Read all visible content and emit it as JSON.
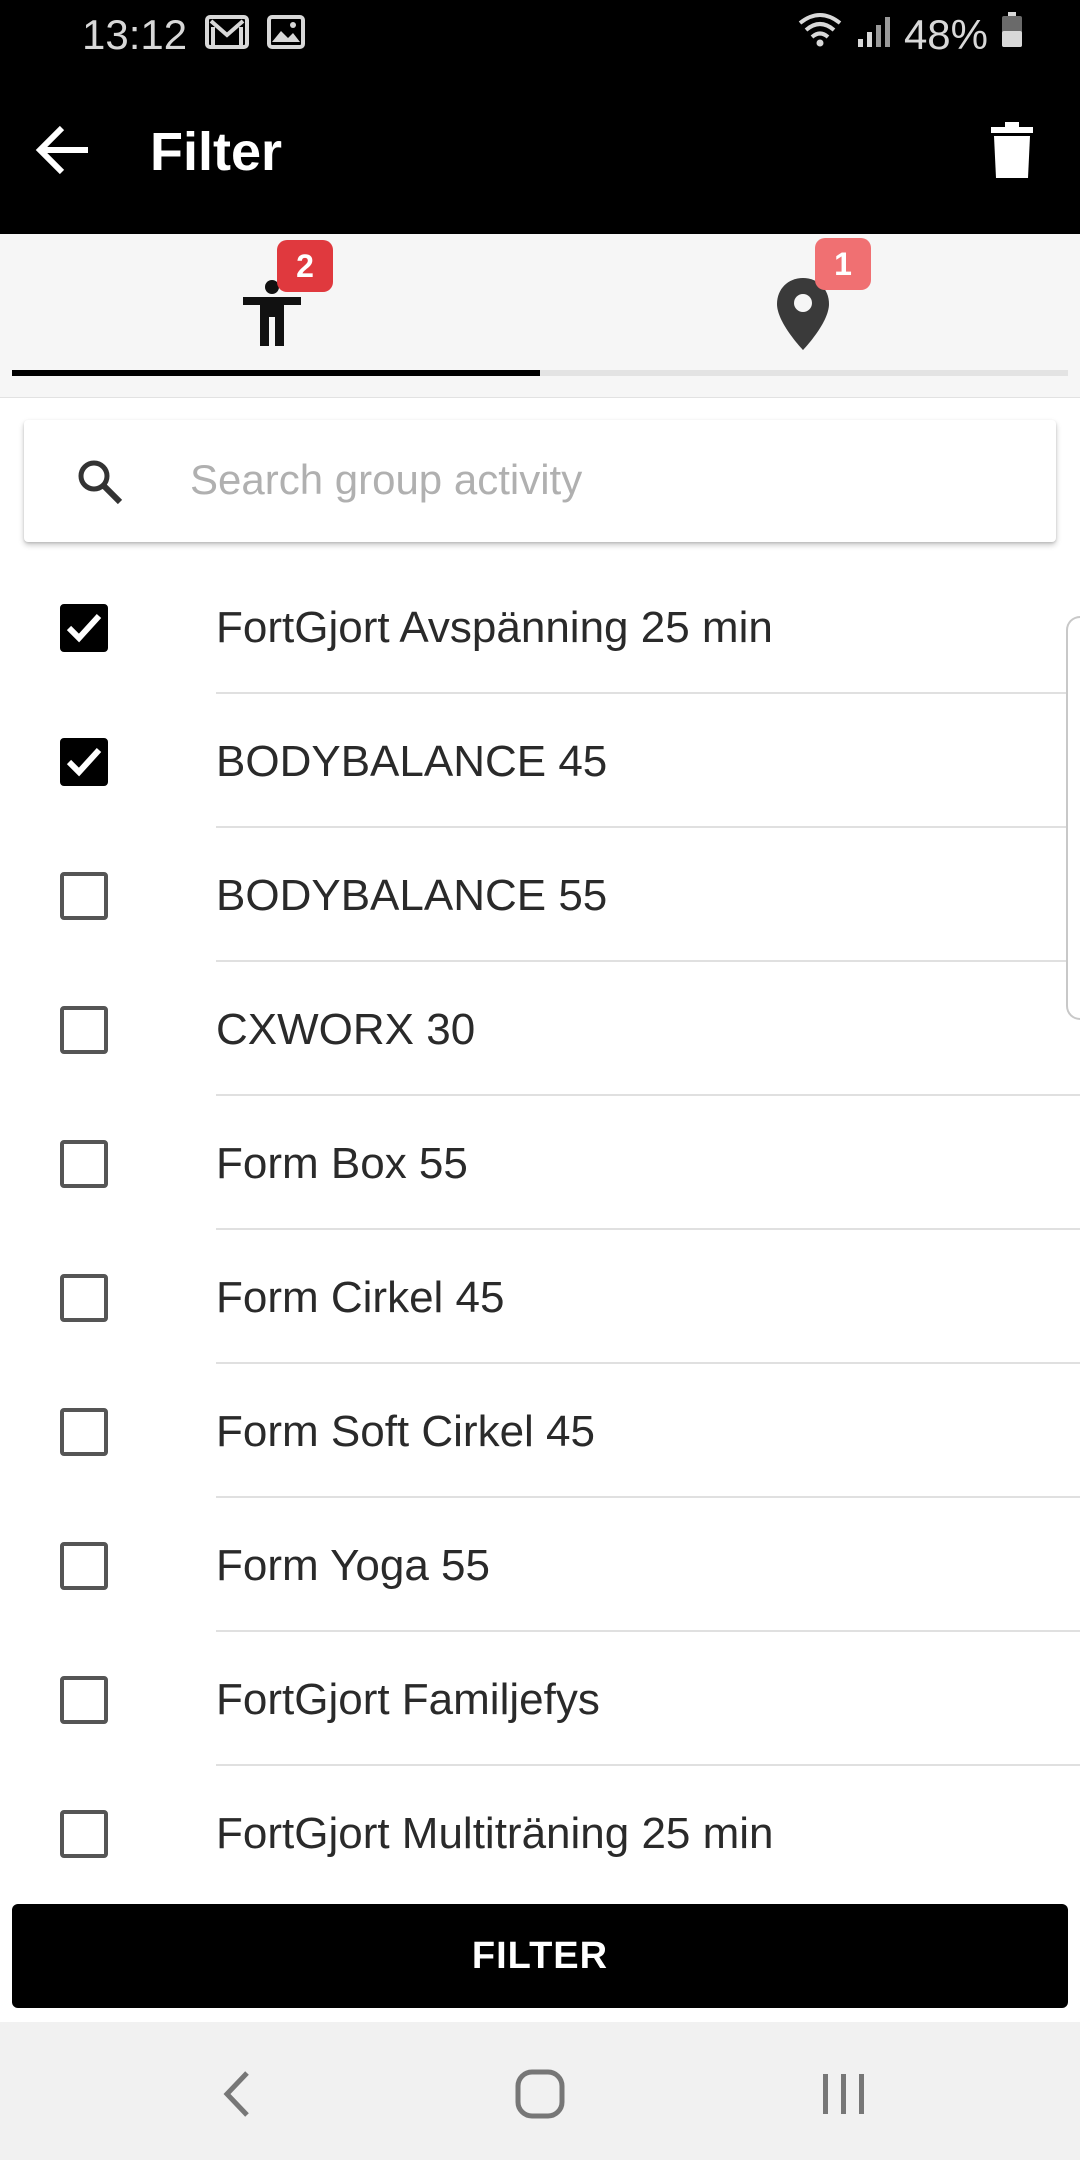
{
  "status_bar": {
    "time": "13:12",
    "battery": "48%",
    "icons": [
      "gmail-icon",
      "image-icon",
      "wifi-icon",
      "signal-icon",
      "battery-icon"
    ]
  },
  "app_bar": {
    "title": "Filter",
    "back_icon": "arrow-left-icon",
    "trash_icon": "trash-icon"
  },
  "tabs": [
    {
      "icon": "person-icon",
      "badge": "2",
      "active": true
    },
    {
      "icon": "location-pin-icon",
      "badge": "1",
      "active": false
    }
  ],
  "search": {
    "placeholder": "Search group activity",
    "value": ""
  },
  "activities": [
    {
      "label": "FortGjort Avspänning 25 min",
      "checked": true
    },
    {
      "label": "BODYBALANCE 45",
      "checked": true
    },
    {
      "label": "BODYBALANCE 55",
      "checked": false
    },
    {
      "label": "CXWORX 30",
      "checked": false
    },
    {
      "label": "Form Box 55",
      "checked": false
    },
    {
      "label": "Form Cirkel 45",
      "checked": false
    },
    {
      "label": "Form Soft Cirkel 45",
      "checked": false
    },
    {
      "label": "Form Yoga 55",
      "checked": false
    },
    {
      "label": "FortGjort Familjefys",
      "checked": false
    },
    {
      "label": "FortGjort Multiträning 25 min",
      "checked": false
    }
  ],
  "filter_button": {
    "label": "FILTER"
  },
  "nav_bar": {
    "icons": [
      "nav-back-icon",
      "nav-home-icon",
      "nav-recent-apps-icon"
    ]
  },
  "colors": {
    "app_bar": "#000000",
    "badge_active": "#e0393e",
    "badge_inactive": "#f07072",
    "tab_bar": "#f6f6f6"
  }
}
